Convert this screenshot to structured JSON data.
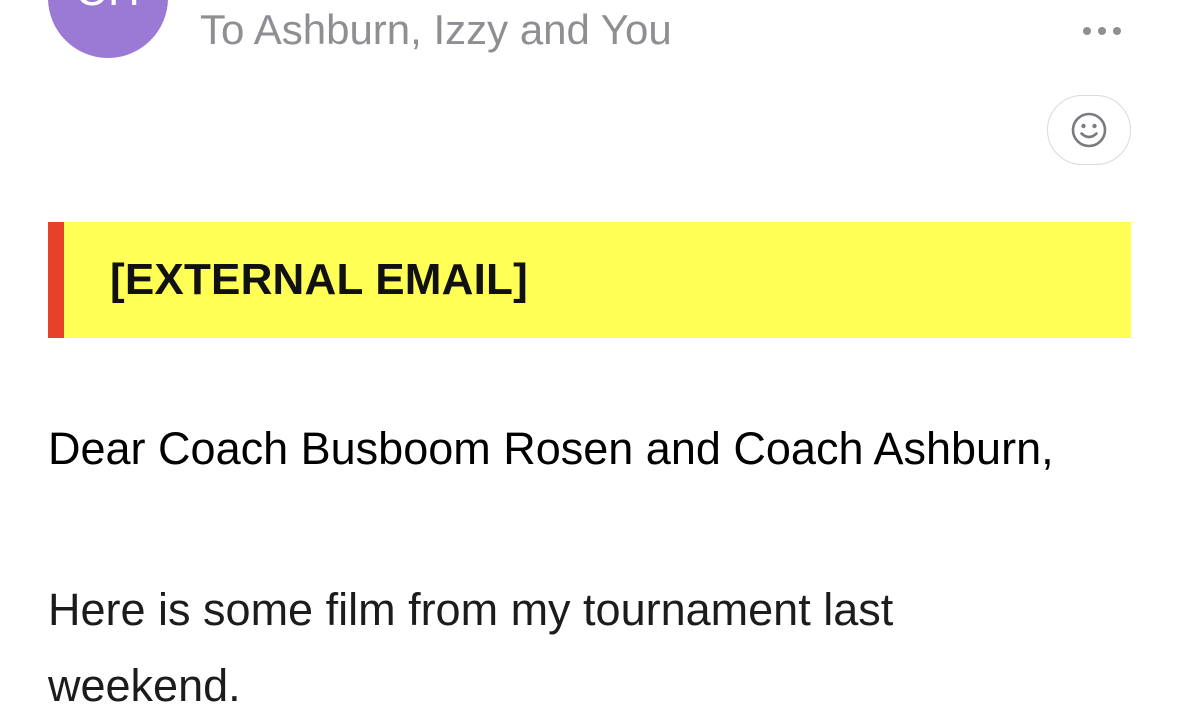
{
  "header": {
    "avatar_initials": "CH",
    "recipients_line": "To Ashburn, Izzy and You"
  },
  "icons": {
    "more": "more-dots-icon",
    "react": "smiley-face-icon"
  },
  "banner": {
    "label": "[EXTERNAL EMAIL]",
    "background_color": "#ffff55",
    "accent_color": "#e8412a"
  },
  "body": {
    "greeting": "Dear Coach Busboom Rosen and Coach Ashburn,",
    "paragraph_1": "Here is some film from my tournament last weekend."
  }
}
